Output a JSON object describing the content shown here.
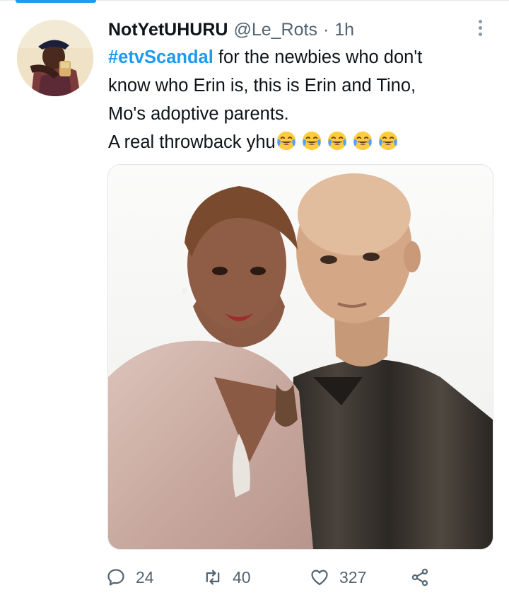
{
  "tweet": {
    "display_name": "NotYetUHURU",
    "handle": "@Le_Rots",
    "separator": "·",
    "time": "1h",
    "hashtag": "#etvScandal",
    "text_line_1": " for the newbies who don't",
    "text_line_2": "know who Erin is, this is Erin and Tino,",
    "text_line_3": "Mo's adoptive parents.",
    "text_line_4": "A real throwback yhu",
    "emoji": [
      "face-with-tears-of-joy",
      "face-with-tears-of-joy",
      "face-with-tears-of-joy",
      "face-with-tears-of-joy",
      "face-with-tears-of-joy"
    ]
  },
  "actions": {
    "reply_count": "24",
    "retweet_count": "40",
    "like_count": "327"
  },
  "icons": {
    "more": "more-vertical-icon",
    "reply": "reply-icon",
    "retweet": "retweet-icon",
    "like": "heart-icon",
    "share": "share-icon"
  },
  "colors": {
    "accent": "#1d9bf0",
    "text": "#0f1419",
    "secondary": "#536471"
  }
}
